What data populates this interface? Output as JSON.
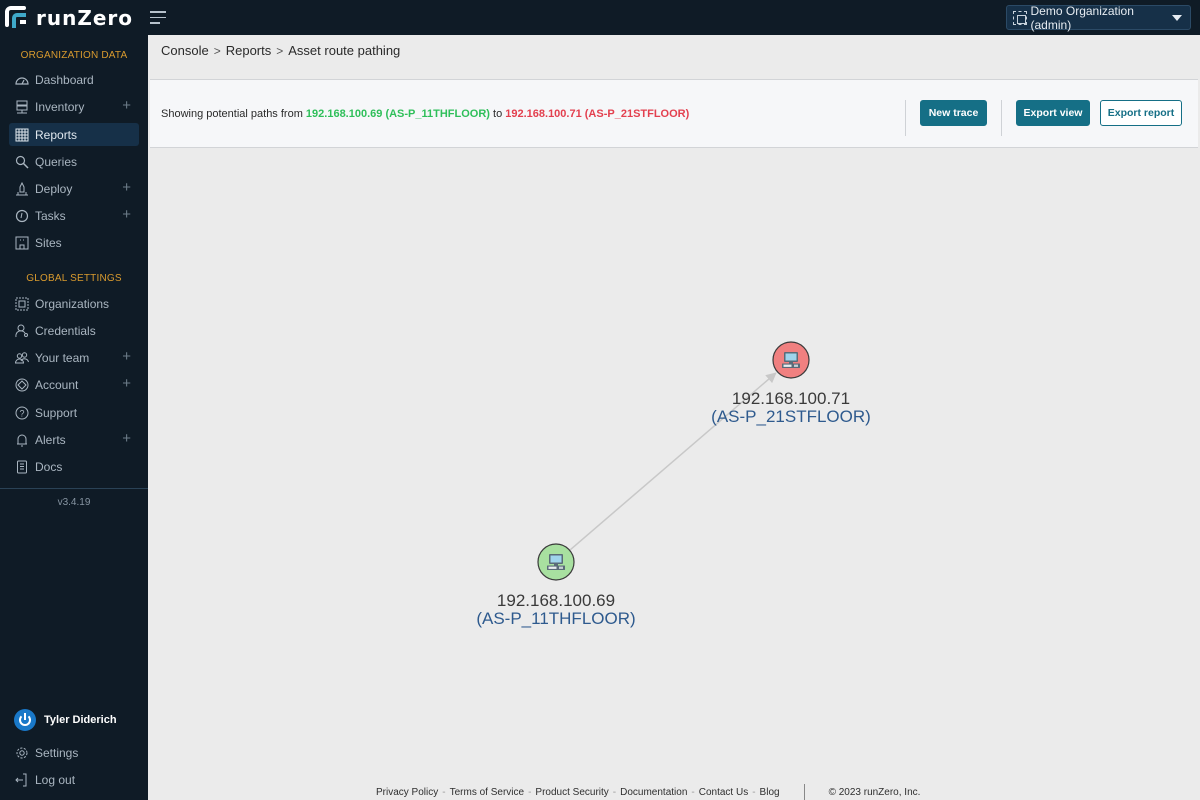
{
  "app": {
    "brand": "runZero",
    "org_selector": "Demo Organization (admin)"
  },
  "sidebar": {
    "org_section_title": "ORGANIZATION DATA",
    "org_items": [
      {
        "label": "Dashboard",
        "icon": "dashboard-icon",
        "expandable": false
      },
      {
        "label": "Inventory",
        "icon": "inventory-icon",
        "expandable": true
      },
      {
        "label": "Reports",
        "icon": "reports-icon",
        "expandable": false,
        "active": true
      },
      {
        "label": "Queries",
        "icon": "queries-icon",
        "expandable": false
      },
      {
        "label": "Deploy",
        "icon": "deploy-icon",
        "expandable": true
      },
      {
        "label": "Tasks",
        "icon": "tasks-icon",
        "expandable": true
      },
      {
        "label": "Sites",
        "icon": "sites-icon",
        "expandable": false
      }
    ],
    "global_section_title": "GLOBAL SETTINGS",
    "global_items": [
      {
        "label": "Organizations",
        "icon": "organizations-icon",
        "expandable": false
      },
      {
        "label": "Credentials",
        "icon": "credentials-icon",
        "expandable": false
      },
      {
        "label": "Your team",
        "icon": "team-icon",
        "expandable": true
      },
      {
        "label": "Account",
        "icon": "account-icon",
        "expandable": true
      },
      {
        "label": "Support",
        "icon": "support-icon",
        "expandable": false
      },
      {
        "label": "Alerts",
        "icon": "alerts-icon",
        "expandable": true
      },
      {
        "label": "Docs",
        "icon": "docs-icon",
        "expandable": false
      }
    ],
    "plus_glyph": "+",
    "version": "v3.4.19",
    "user_name": "Tyler Diderich",
    "bottom_items": [
      {
        "label": "Settings",
        "icon": "gear-icon"
      },
      {
        "label": "Log out",
        "icon": "logout-icon"
      }
    ]
  },
  "breadcrumb": {
    "items": [
      "Console",
      "Reports",
      "Asset route pathing"
    ],
    "separator": ">"
  },
  "infobar": {
    "prefix": "Showing potential paths from ",
    "from": "192.168.100.69 (AS-P_11THFLOOR)",
    "middle": " to ",
    "to": "192.168.100.71 (AS-P_21STFLOOR)",
    "buttons": {
      "new_trace": "New trace",
      "export_view": "Export view",
      "export_report": "Export report"
    }
  },
  "graph": {
    "nodes": [
      {
        "id": "source",
        "ip": "192.168.100.69",
        "name": "(AS-P_11THFLOOR)",
        "role": "source",
        "color": "#a8e0a0"
      },
      {
        "id": "target",
        "ip": "192.168.100.71",
        "name": "(AS-P_21STFLOOR)",
        "role": "target",
        "color": "#f08080"
      }
    ],
    "edges": [
      {
        "from": "source",
        "to": "target"
      }
    ]
  },
  "footer": {
    "links": [
      "Privacy Policy",
      "Terms of Service",
      "Product Security",
      "Documentation",
      "Contact Us",
      "Blog"
    ],
    "dash": "-",
    "copyright": "© 2023 runZero, Inc."
  }
}
